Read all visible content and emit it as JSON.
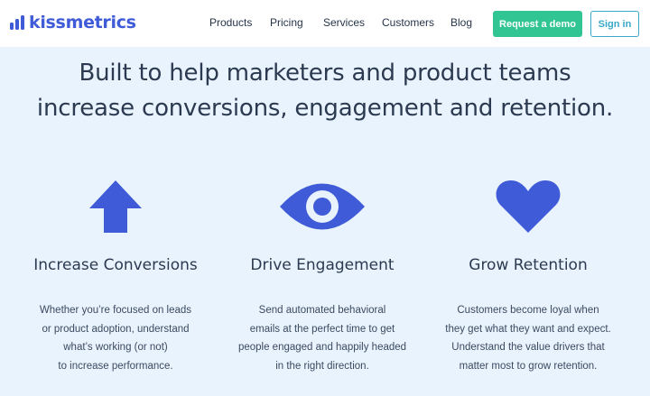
{
  "brand": {
    "name": "kissmetrics",
    "logo_icon": "bar-chart-icon",
    "color": "#3f5bd8"
  },
  "nav": {
    "items": [
      {
        "label": "Products"
      },
      {
        "label": "Pricing"
      },
      {
        "label": "Services"
      },
      {
        "label": "Customers"
      },
      {
        "label": "Blog"
      }
    ],
    "cta_label": "Request a demo",
    "signin_label": "Sign in"
  },
  "hero": {
    "line1": "Built to help marketers and product teams",
    "line2": "increase conversions, engagement and retention."
  },
  "features": [
    {
      "icon": "arrow-up-icon",
      "title": "Increase Conversions",
      "desc": [
        "Whether you’re focused on leads",
        "or product adoption, understand",
        "what’s working (or not)",
        "to increase performance."
      ]
    },
    {
      "icon": "eye-icon",
      "title": "Drive Engagement",
      "desc": [
        "Send automated behavioral",
        "emails at the perfect time to get",
        "people engaged and happily headed",
        "in the right direction."
      ]
    },
    {
      "icon": "heart-icon",
      "title": "Grow Retention",
      "desc": [
        "Customers become loyal when",
        "they get what they want and expect.",
        "Understand the value drivers that",
        "matter most to grow retention."
      ]
    }
  ],
  "colors": {
    "accent": "#3f5bd8",
    "cta": "#32c594",
    "signin": "#3ba7c9",
    "background": "#e9f3fd"
  }
}
